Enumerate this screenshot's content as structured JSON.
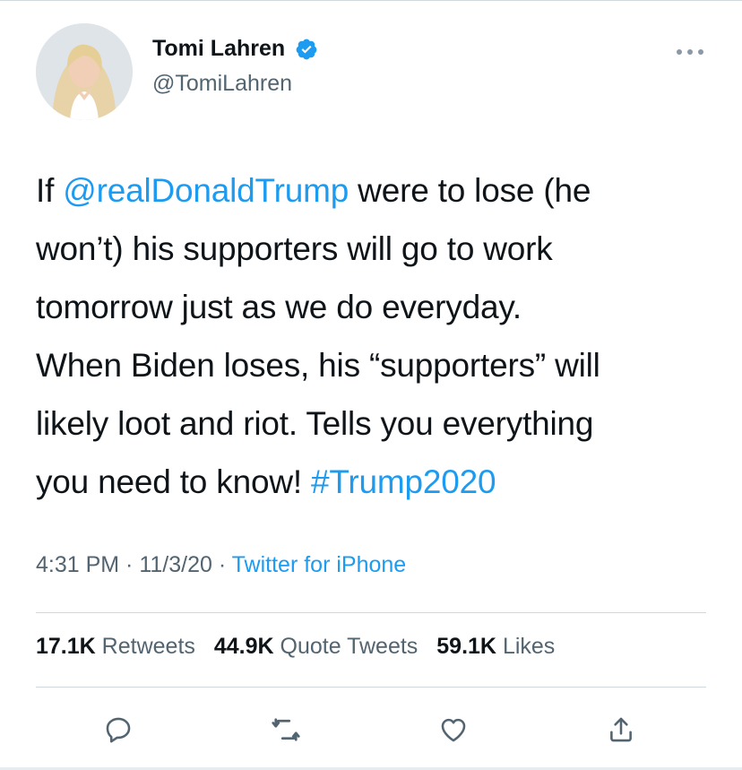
{
  "author": {
    "display_name": "Tomi Lahren",
    "handle": "@TomiLahren",
    "verified_icon": "verified-badge-icon"
  },
  "tweet": {
    "line1_pre": "If ",
    "mention": "@realDonaldTrump",
    "line1_post": " were to lose (he",
    "line2": "won’t) his supporters will go to work",
    "line3": "tomorrow just as we do everyday.",
    "line4": "When Biden loses, his “supporters” will",
    "line5": "likely loot and riot. Tells you everything",
    "line6_pre": "you need to know! ",
    "hashtag": "#Trump2020"
  },
  "meta": {
    "time": "4:31 PM",
    "sep1": " · ",
    "date": "11/3/20",
    "sep2": " · ",
    "source": "Twitter for iPhone"
  },
  "stats": {
    "retweets_count": "17.1K",
    "retweets_label": "Retweets",
    "quotes_count": "44.9K",
    "quotes_label": "Quote Tweets",
    "likes_count": "59.1K",
    "likes_label": "Likes"
  },
  "actions": [
    "reply-icon",
    "retweet-icon",
    "like-icon",
    "share-icon"
  ],
  "colors": {
    "accent": "#1d9bf0",
    "text": "#0f1419",
    "secondary": "#536471",
    "divider": "#cfd9de"
  }
}
